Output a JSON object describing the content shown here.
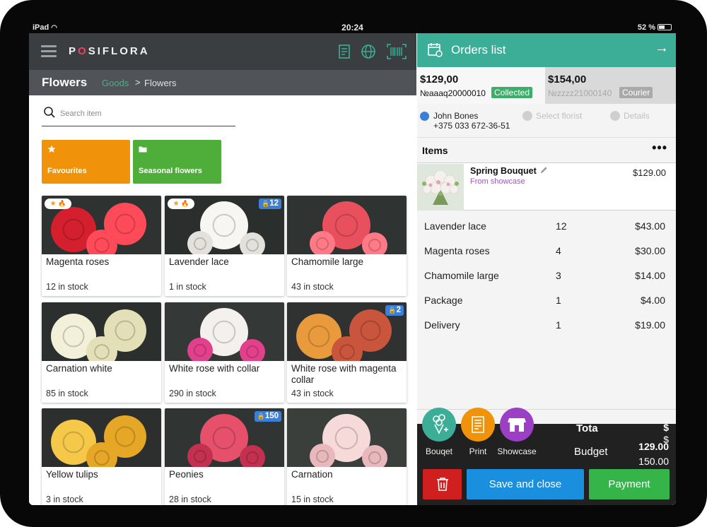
{
  "status_bar": {
    "device": "iPad",
    "time": "20:24",
    "battery": "52 %",
    "battery_level": 0.52
  },
  "app": {
    "logo": "POSIFLORA"
  },
  "header": {
    "section_title": "Flowers",
    "breadcrumb": [
      "Goods",
      ">",
      "Flowers"
    ]
  },
  "search": {
    "placeholder": "Search item",
    "value": ""
  },
  "categories": [
    {
      "label": "Favourites",
      "icon": "star-icon",
      "color": "#f0930a"
    },
    {
      "label": "Seasonal flowers",
      "icon": "folder-icon",
      "color": "#4fae3a"
    }
  ],
  "products": [
    {
      "name": "Magenta roses",
      "stock": "12 in stock",
      "favourite": true,
      "lock": ""
    },
    {
      "name": "Lavender lace",
      "stock": "1 in stock",
      "favourite": true,
      "lock": "12"
    },
    {
      "name": "Chamomile large",
      "stock": "43 in stock",
      "favourite": false,
      "lock": ""
    },
    {
      "name": "Carnation white",
      "stock": "85 in stock",
      "favourite": false,
      "lock": ""
    },
    {
      "name": "White rose with collar",
      "stock": "290 in stock",
      "favourite": false,
      "lock": ""
    },
    {
      "name": "White rose with magenta collar",
      "stock": "43 in stock",
      "favourite": false,
      "lock": "2"
    },
    {
      "name": "Yellow tulips",
      "stock": "3 in stock",
      "favourite": false,
      "lock": ""
    },
    {
      "name": "Peonies",
      "stock": "28 in stock",
      "favourite": false,
      "lock": "150"
    },
    {
      "name": "Carnation",
      "stock": "15 in stock",
      "favourite": false,
      "lock": ""
    }
  ],
  "badges": {
    "fav_star": "★",
    "fav_fire": "🔥",
    "lock": "🔒"
  },
  "orders_panel": {
    "title": "Orders list",
    "arrow": "→",
    "orders": [
      {
        "price": "$129,00",
        "number": "№aaaq20000010",
        "status": "Collected",
        "status_color": "#3cae6a"
      },
      {
        "price": "$154,00",
        "number": "№zzzz21000140",
        "status": "Courier",
        "status_color": "#a9a9a9"
      }
    ],
    "customer": {
      "name": "John Bones",
      "phone": "+375 033 672-36-51"
    },
    "select_florist": "Select florist",
    "details": "Details",
    "items_title": "Items",
    "more": "•••",
    "bouquet": {
      "name": "Spring Bouquet",
      "source": "From showcase",
      "price": "$129.00"
    },
    "lines": [
      {
        "name": "Lavender lace",
        "qty": "12",
        "price": "$43.00"
      },
      {
        "name": "Magenta roses",
        "qty": "4",
        "price": "$30.00"
      },
      {
        "name": "Chamomile large",
        "qty": "3",
        "price": "$14.00"
      },
      {
        "name": "Package",
        "qty": "1",
        "price": "$4.00"
      },
      {
        "name": "Delivery",
        "qty": "1",
        "price": "$19.00"
      }
    ],
    "actions": [
      {
        "label": "Bouqet",
        "color": "#3cae98",
        "icon": "bouquet-icon"
      },
      {
        "label": "Print",
        "color": "#f0930a",
        "icon": "print-icon"
      },
      {
        "label": "Showcase",
        "color": "#9b3fc4",
        "icon": "showcase-icon"
      }
    ],
    "total_label": "Tota",
    "total_value": "$",
    "total_value_2": "$",
    "budget_label": "Budget",
    "budget_value": "129.00",
    "budget_value_2": "150.00",
    "delete_icon": "trash-icon",
    "save_label": "Save and close",
    "payment_label": "Payment",
    "colors": {
      "delete": "#cf1f1f",
      "save": "#1a8fdd",
      "payment": "#35b44a"
    }
  }
}
